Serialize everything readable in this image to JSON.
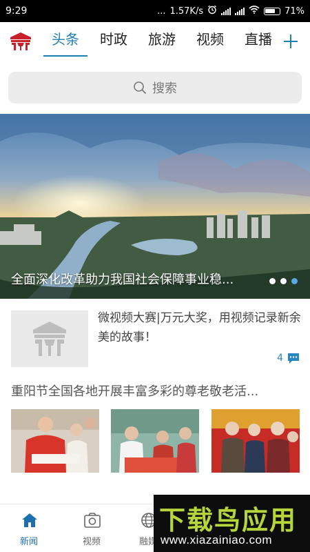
{
  "status_bar": {
    "time": "9:29",
    "dots": "...",
    "speed": "1.57K/s",
    "battery": "71%"
  },
  "header": {
    "logo_icon": "cctv-news-logo-icon",
    "tabs": [
      {
        "label": "头条",
        "active": true
      },
      {
        "label": "时政",
        "active": false
      },
      {
        "label": "旅游",
        "active": false
      },
      {
        "label": "视频",
        "active": false
      },
      {
        "label": "直播",
        "active": false
      }
    ],
    "add_icon": "plus-icon"
  },
  "search": {
    "placeholder": "搜索",
    "icon": "search-icon"
  },
  "banner": {
    "caption": "全面深化改革助力我国社会保障事业稳...",
    "dots_total": 3,
    "active_dot": 3
  },
  "news": [
    {
      "title": "微视频大赛|万元大奖，用视频记录新余美的故事！",
      "comments": "4",
      "comment_icon": "comment-bubble-icon",
      "thumb_icon": "placeholder-logo-icon"
    }
  ],
  "gallery_news": {
    "title": "重阳节全国各地开展丰富多彩的尊老敬老活..."
  },
  "bottom_nav": {
    "items": [
      {
        "label": "新闻",
        "icon": "home-icon",
        "active": true
      },
      {
        "label": "视频",
        "icon": "camera-icon",
        "active": false
      },
      {
        "label": "融媒",
        "icon": "globe-icon",
        "active": false
      }
    ]
  },
  "watermark": {
    "brand": "下载鸟应用",
    "url": "www.xiazainiao.com"
  },
  "colors": {
    "accent": "#1f7fb0",
    "status_bar": "#000000",
    "search_bg": "#ececec",
    "watermark_green": "#b5d63b"
  }
}
